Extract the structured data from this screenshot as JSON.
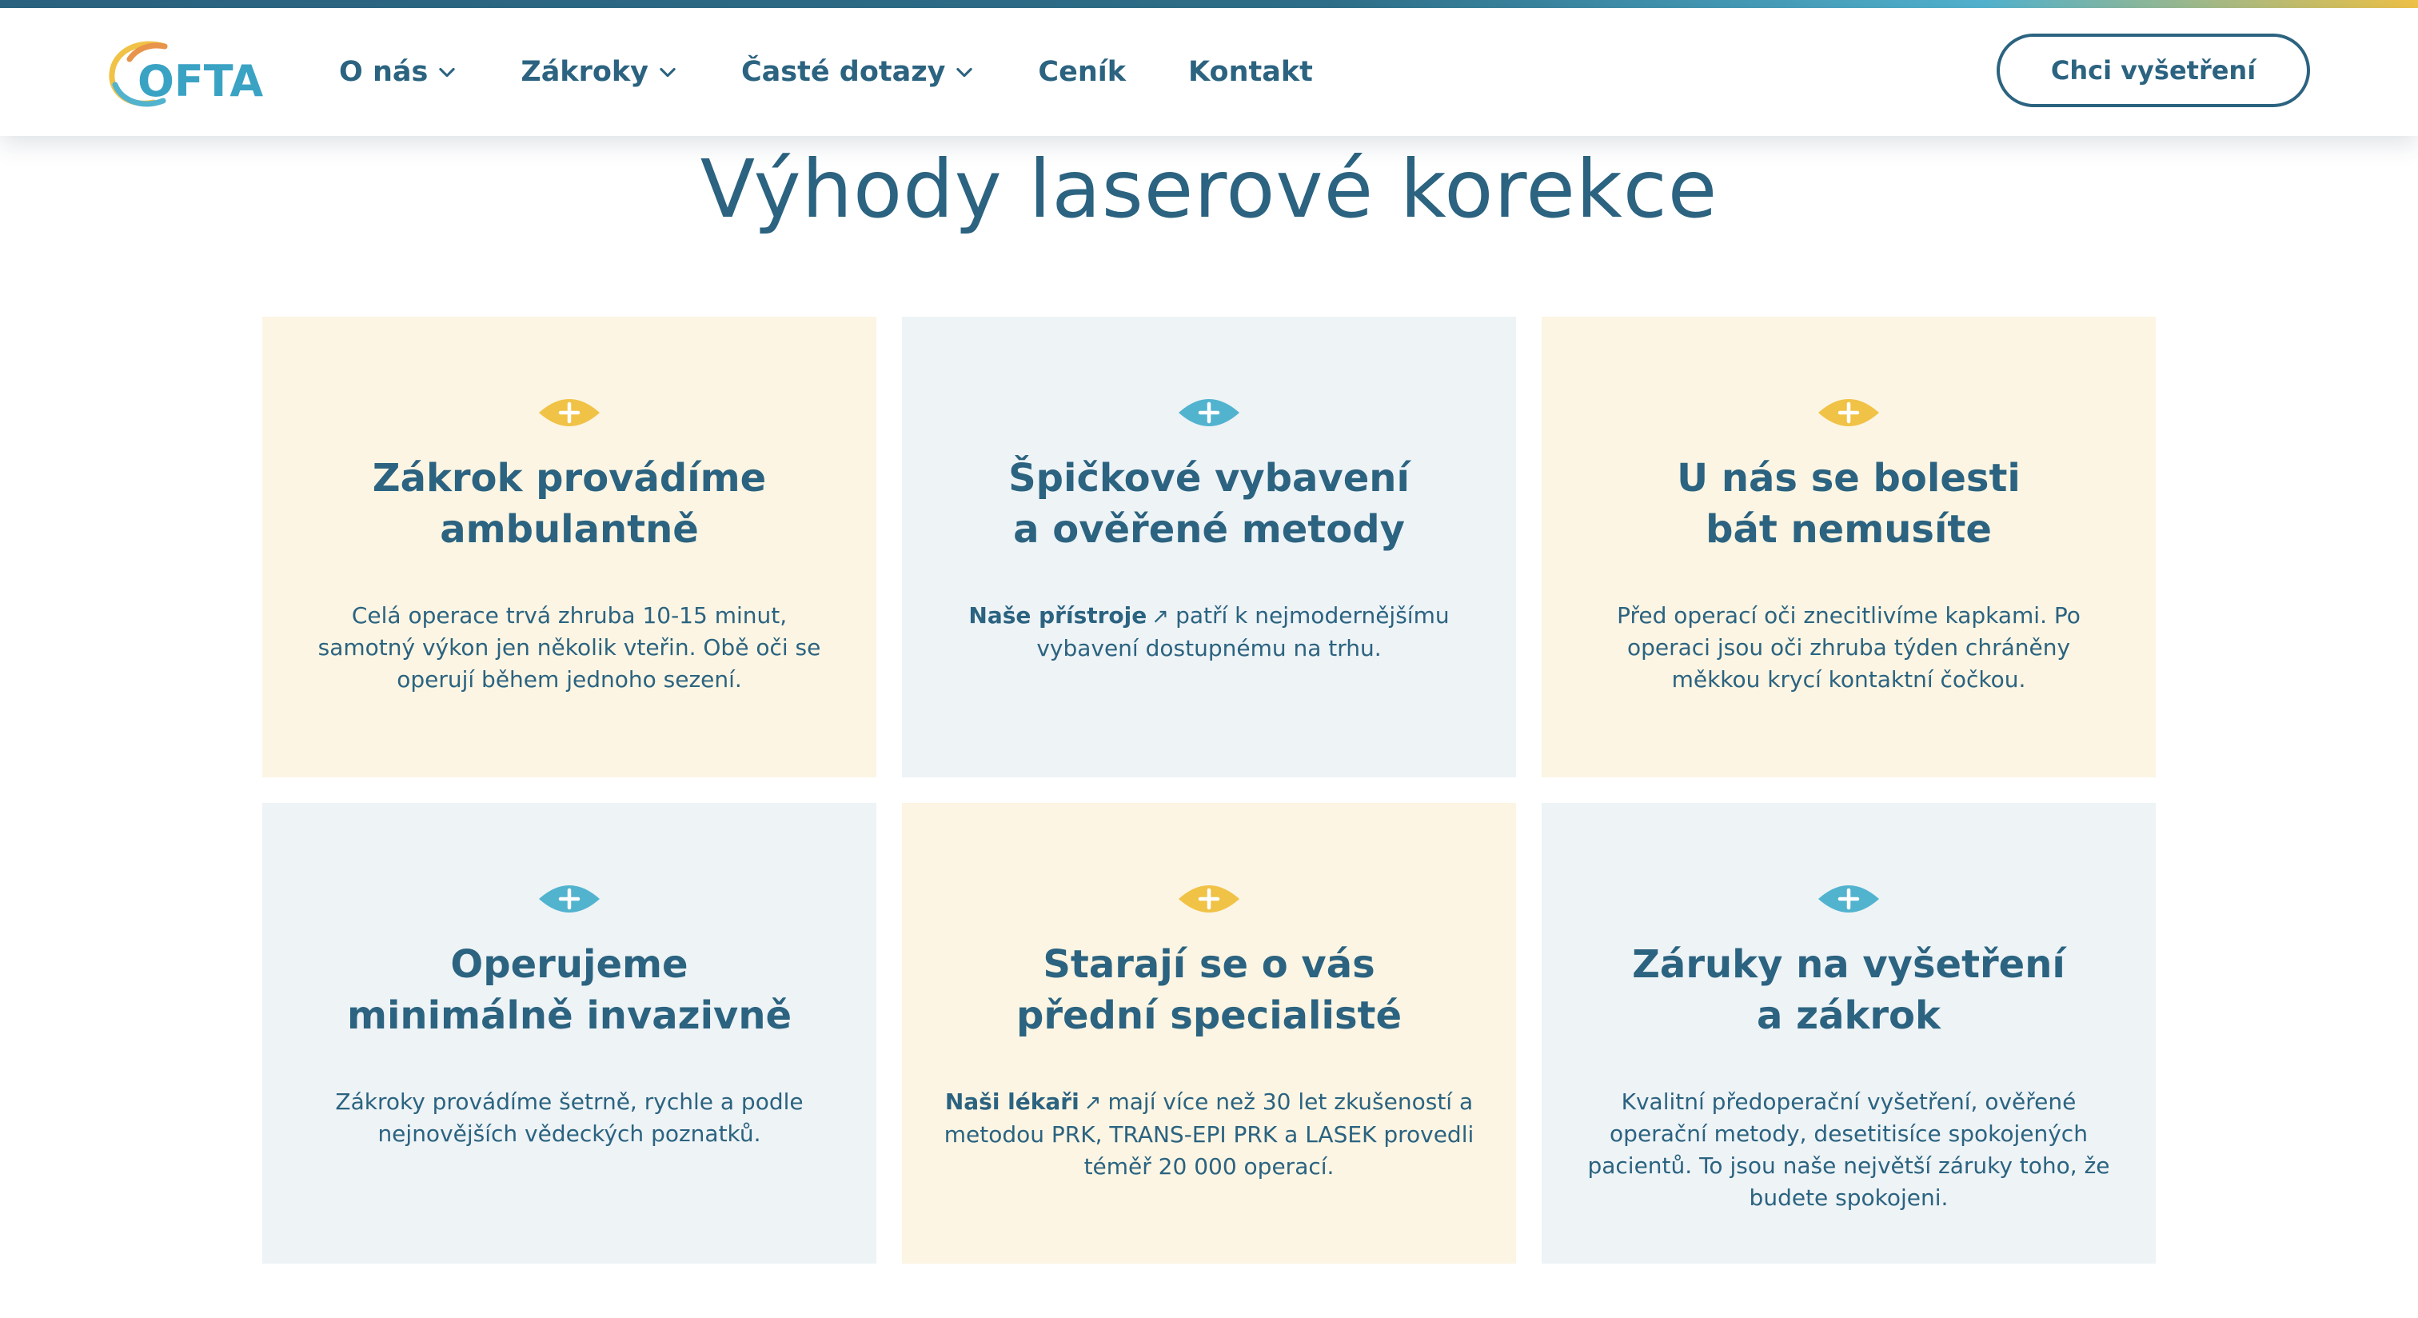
{
  "header": {
    "logo_text": "OFTA",
    "nav": [
      {
        "label": "O nás",
        "has_dropdown": true
      },
      {
        "label": "Zákroky",
        "has_dropdown": true
      },
      {
        "label": "Časté dotazy",
        "has_dropdown": true
      },
      {
        "label": "Ceník",
        "has_dropdown": false
      },
      {
        "label": "Kontakt",
        "has_dropdown": false
      }
    ],
    "cta_label": "Chci vyšetření"
  },
  "section": {
    "title": "Výhody laserové korekce"
  },
  "cards": [
    {
      "theme": "yellow",
      "icon": "eye-plus-icon",
      "title_line1": "Zákrok provádíme",
      "title_line2": "ambulantně",
      "text": "Celá operace trvá zhruba 10-15 minut, samotný výkon jen několik vteřin. Obě oči se operují během jednoho sezení."
    },
    {
      "theme": "blue",
      "icon": "eye-plus-icon",
      "title_line1": "Špičkové vybavení",
      "title_line2": "a ověřené metody",
      "link": "Naše přístroje",
      "link_arrow": "↗",
      "text": "patří k nejmodernějšímu vybavení dostupnému na trhu."
    },
    {
      "theme": "yellow",
      "icon": "eye-plus-icon",
      "title_line1": "U nás se bolesti",
      "title_line2": "bát nemusíte",
      "text": "Před operací oči znecitlivíme kapkami. Po operaci jsou oči zhruba týden chráněny měkkou krycí kontaktní čočkou."
    },
    {
      "theme": "blue",
      "icon": "eye-plus-icon",
      "title_line1": "Operujeme",
      "title_line2": "minimálně invazivně",
      "text": "Zákroky provádíme šetrně, rychle a podle nejnovějších vědeckých poznatků."
    },
    {
      "theme": "yellow",
      "icon": "eye-plus-icon",
      "title_line1": "Starají se o vás",
      "title_line2": "přední specialisté",
      "link": "Naši lékaři",
      "link_arrow": "↗",
      "text": "mají více než 30 let zkušeností a metodou PRK, TRANS-EPI PRK a LASEK provedli téměř 20 000 operací."
    },
    {
      "theme": "blue",
      "icon": "eye-plus-icon",
      "title_line1": "Záruky na vyšetření",
      "title_line2": "a zákrok",
      "text": "Kvalitní předoperační vyšetření, ověřené operační metody, desetitisíce spokojených pacientů. To jsou naše největší záruky toho, že budete spokojeni."
    }
  ],
  "colors": {
    "primary": "#2b6380",
    "accent_yellow": "#f0c246",
    "accent_blue": "#52b3cf",
    "card_yellow_bg": "#fcf5e3",
    "card_blue_bg": "#eef3f6"
  }
}
